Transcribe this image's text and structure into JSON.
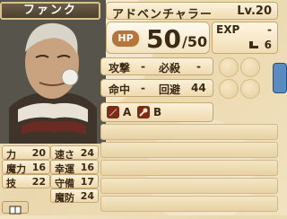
{
  "unit": {
    "name": "ファンク",
    "class": "アドベンチャラー",
    "level_label": "Lv.",
    "level": "20",
    "hp_label": "HP",
    "hp_current": "50",
    "hp_max": "/50",
    "exp_label": "EXP",
    "exp_value": "-",
    "move_value": "6"
  },
  "combat": {
    "attack_label": "攻撃",
    "attack_value": "-",
    "crit_label": "必殺",
    "crit_value": "-",
    "hit_label": "命中",
    "hit_value": "-",
    "avoid_label": "回避",
    "avoid_value": "44"
  },
  "weapons": [
    {
      "icon": "sword-icon",
      "rank": "A"
    },
    {
      "icon": "staff-icon",
      "rank": "B"
    }
  ],
  "stats": [
    {
      "label": "力",
      "value": "20"
    },
    {
      "label": "速さ",
      "value": "24"
    },
    {
      "label": "魔力",
      "value": "16"
    },
    {
      "label": "幸運",
      "value": "16"
    },
    {
      "label": "技",
      "value": "22"
    },
    {
      "label": "守備",
      "value": "17"
    },
    {
      "label": "魔防",
      "value": "24"
    }
  ],
  "colors": {
    "panel": "#efdab0",
    "hp_badge": "#b8753a",
    "text": "#3b2a14"
  }
}
